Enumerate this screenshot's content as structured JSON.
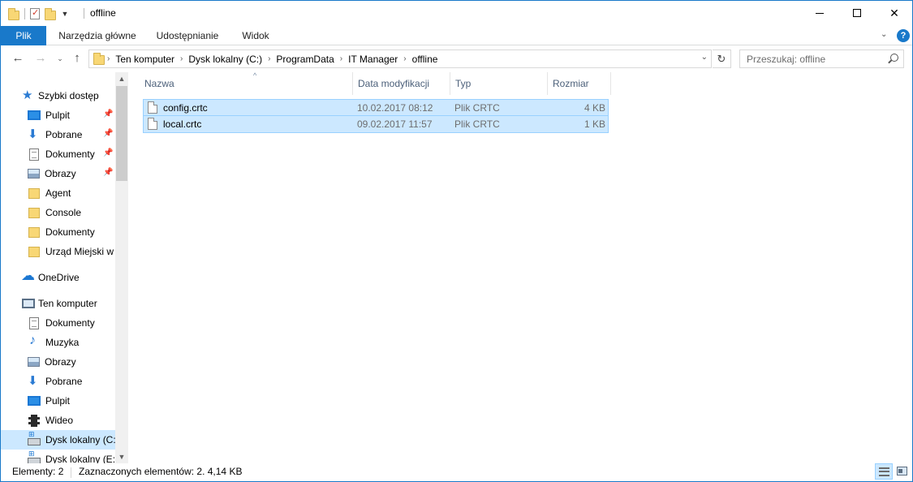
{
  "window": {
    "title": "offline"
  },
  "ribbon": {
    "tabs": [
      "Plik",
      "Narzędzia główne",
      "Udostępnianie",
      "Widok"
    ]
  },
  "address": {
    "crumbs": [
      "Ten komputer",
      "Dysk lokalny (C:)",
      "ProgramData",
      "IT Manager",
      "offline"
    ]
  },
  "search": {
    "placeholder": "Przeszukaj: offline"
  },
  "navpane": {
    "items": [
      {
        "label": "Szybki dostęp",
        "icon": "star-icon"
      },
      {
        "label": "Pulpit",
        "icon": "desktop-icon"
      },
      {
        "label": "Pobrane",
        "icon": "downloads-icon"
      },
      {
        "label": "Dokumenty",
        "icon": "documents-icon"
      },
      {
        "label": "Obrazy",
        "icon": "pictures-icon"
      },
      {
        "label": "Agent",
        "icon": "folder-icon"
      },
      {
        "label": "Console",
        "icon": "folder-icon"
      },
      {
        "label": "Dokumenty",
        "icon": "folder-icon"
      },
      {
        "label": "Urząd Miejski w",
        "icon": "folder-icon"
      },
      {
        "label": "OneDrive",
        "icon": "onedrive-icon"
      },
      {
        "label": "Ten komputer",
        "icon": "computer-icon"
      },
      {
        "label": "Dokumenty",
        "icon": "documents-icon"
      },
      {
        "label": "Muzyka",
        "icon": "music-icon"
      },
      {
        "label": "Obrazy",
        "icon": "pictures-icon"
      },
      {
        "label": "Pobrane",
        "icon": "downloads-icon"
      },
      {
        "label": "Pulpit",
        "icon": "desktop-icon"
      },
      {
        "label": "Wideo",
        "icon": "video-icon"
      },
      {
        "label": "Dysk lokalny (C:)",
        "icon": "drive-icon"
      },
      {
        "label": "Dysk lokalny (E:)",
        "icon": "drive-icon"
      }
    ]
  },
  "filelist": {
    "columns": [
      "Nazwa",
      "Data modyfikacji",
      "Typ",
      "Rozmiar"
    ],
    "rows": [
      {
        "name": "config.crtc",
        "date": "10.02.2017 08:12",
        "type": "Plik CRTC",
        "size": "4 KB"
      },
      {
        "name": "local.crtc",
        "date": "09.02.2017 11:57",
        "type": "Plik CRTC",
        "size": "1 KB"
      }
    ]
  },
  "status": {
    "count": "Elementy: 2",
    "selected": "Zaznaczonych elementów: 2. 4,14 KB"
  },
  "colors": {
    "accent": "#1979ca",
    "selection": "#cce8ff",
    "selection_border": "#99d1ff"
  }
}
